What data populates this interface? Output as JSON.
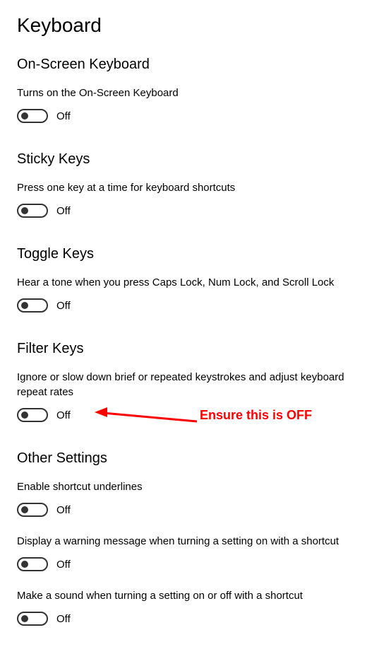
{
  "title": "Keyboard",
  "sections": {
    "onscreen": {
      "heading": "On-Screen Keyboard",
      "desc": "Turns on the On-Screen Keyboard",
      "toggle_state": "Off"
    },
    "sticky": {
      "heading": "Sticky Keys",
      "desc": "Press one key at a time for keyboard shortcuts",
      "toggle_state": "Off"
    },
    "togglekeys": {
      "heading": "Toggle Keys",
      "desc": "Hear a tone when you press Caps Lock, Num Lock, and Scroll Lock",
      "toggle_state": "Off"
    },
    "filter": {
      "heading": "Filter Keys",
      "desc": "Ignore or slow down brief or repeated keystrokes and adjust keyboard repeat rates",
      "toggle_state": "Off"
    },
    "other": {
      "heading": "Other Settings",
      "underlines_desc": "Enable shortcut underlines",
      "underlines_state": "Off",
      "warning_desc": "Display a warning message when turning a setting on with a shortcut",
      "warning_state": "Off",
      "sound_desc": "Make a sound when turning a setting on or off with a shortcut",
      "sound_state": "Off"
    }
  },
  "annotation": {
    "text": "Ensure this is OFF",
    "color": "#ff0000"
  }
}
